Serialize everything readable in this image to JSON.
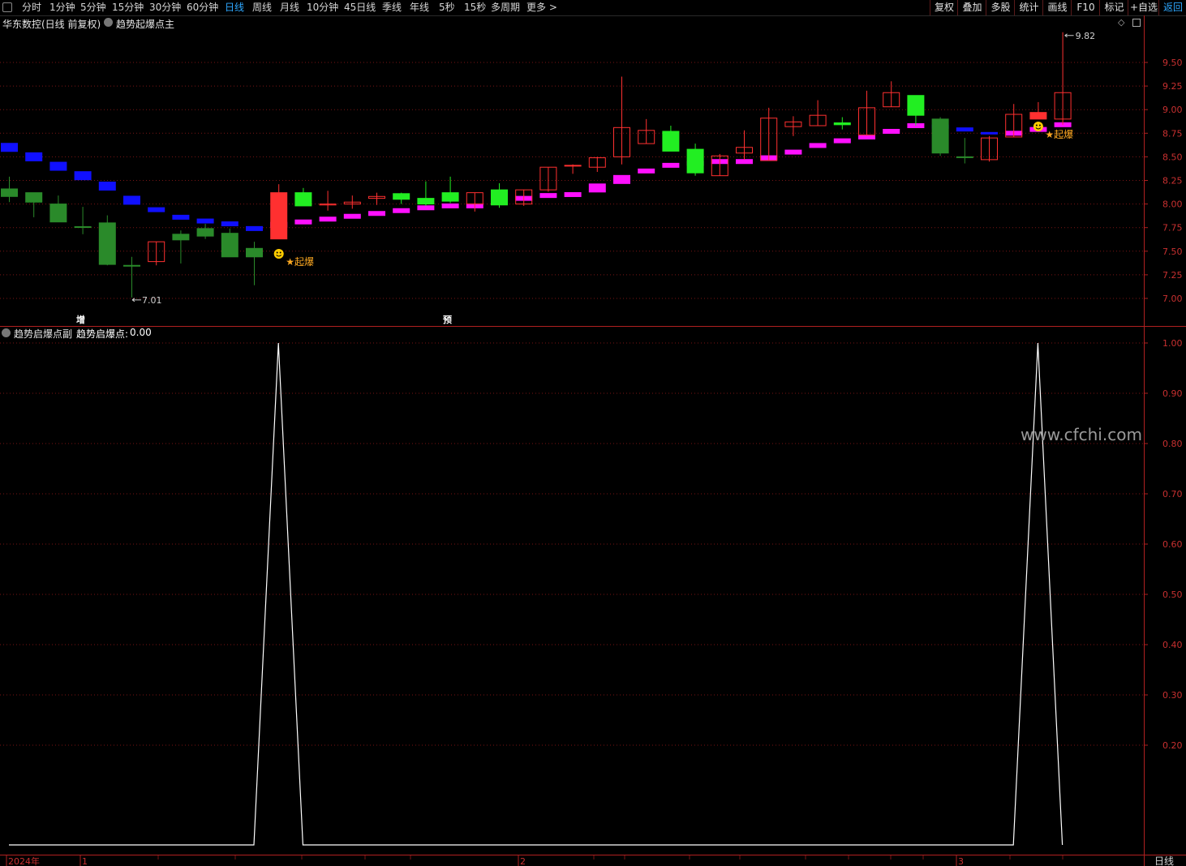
{
  "toolbar": {
    "periods": [
      "分时",
      "1分钟",
      "5分钟",
      "15分钟",
      "30分钟",
      "60分钟",
      "日线",
      "周线",
      "月线",
      "10分钟",
      "45日线",
      "季线",
      "年线",
      "5秒",
      "15秒",
      "多周期",
      "更多 >"
    ],
    "active_period": "日线",
    "actions": [
      "复权",
      "叠加",
      "多股",
      "统计",
      "画线",
      "F10",
      "标记",
      "+自选",
      "返回"
    ]
  },
  "main_panel": {
    "title": "华东数控(日线 前复权)",
    "indicator_name": "趋势起爆点主",
    "price_axis": [
      "9.50",
      "9.25",
      "9.00",
      "8.75",
      "8.50",
      "8.25",
      "8.00",
      "7.75",
      "7.50",
      "7.25",
      "7.00"
    ],
    "high_label": "9.82",
    "low_label": "7.01",
    "signal_label": "★起爆",
    "marker_zeng": "增",
    "marker_yu": "预"
  },
  "sub_panel": {
    "indicator_name": "趋势启爆点副",
    "value_label": "趋势启爆点:",
    "value": "0.00",
    "axis": [
      "1.00",
      "0.90",
      "0.80",
      "0.70",
      "0.60",
      "0.50",
      "0.40",
      "0.30",
      "0.20"
    ]
  },
  "date_axis": {
    "labels": [
      "2024年",
      "1",
      "2",
      "3"
    ],
    "period": "日线"
  },
  "watermark": "www.cfchi.com",
  "colors": {
    "up": "#ff3030",
    "down_dark": "#2a8a2a",
    "down_bright": "#22ee22",
    "band_down": "#1010ff",
    "band_up": "#ff10ff",
    "grid": "#7a1515",
    "active": "#2ea8ff"
  },
  "chart_data": {
    "type": "candlestick",
    "ylim": [
      6.9,
      9.9
    ],
    "candles": [
      {
        "o": 8.16,
        "h": 8.29,
        "l": 8.02,
        "c": 8.08,
        "dir": "down",
        "band": 8.6,
        "bc": "blue"
      },
      {
        "o": 8.12,
        "h": 8.12,
        "l": 7.86,
        "c": 8.02,
        "dir": "down",
        "band": 8.5,
        "bc": "blue"
      },
      {
        "o": 8.0,
        "h": 8.09,
        "l": 7.81,
        "c": 7.81,
        "dir": "down",
        "band": 8.4,
        "bc": "blue"
      },
      {
        "o": 7.76,
        "h": 7.97,
        "l": 7.68,
        "c": 7.76,
        "dir": "down",
        "band": 8.3,
        "bc": "blue"
      },
      {
        "o": 7.8,
        "h": 7.88,
        "l": 7.35,
        "c": 7.36,
        "dir": "down",
        "band": 8.19,
        "bc": "blue"
      },
      {
        "o": 7.35,
        "h": 7.44,
        "l": 7.01,
        "c": 7.35,
        "dir": "down",
        "band": 8.04,
        "bc": "blue"
      },
      {
        "o": 7.39,
        "h": 7.6,
        "l": 7.35,
        "c": 7.6,
        "dir": "up",
        "band": 7.94,
        "bc": "blue"
      },
      {
        "o": 7.62,
        "h": 7.72,
        "l": 7.37,
        "c": 7.68,
        "dir": "down",
        "band": 7.86,
        "bc": "blue"
      },
      {
        "o": 7.66,
        "h": 7.79,
        "l": 7.63,
        "c": 7.74,
        "dir": "down",
        "band": 7.82,
        "bc": "blue"
      },
      {
        "o": 7.69,
        "h": 7.74,
        "l": 7.44,
        "c": 7.44,
        "dir": "down",
        "band": 7.79,
        "bc": "blue"
      },
      {
        "o": 7.53,
        "h": 7.6,
        "l": 7.14,
        "c": 7.44,
        "dir": "down",
        "band": 7.74,
        "bc": "blue"
      },
      {
        "o": 7.63,
        "h": 8.21,
        "l": 7.63,
        "c": 8.12,
        "dir": "up",
        "band": 7.78,
        "bc": "mag",
        "signal": true
      },
      {
        "o": 8.12,
        "h": 8.17,
        "l": 7.98,
        "c": 7.98,
        "dir": "downb",
        "band": 7.81,
        "bc": "mag"
      },
      {
        "o": 8.0,
        "h": 8.14,
        "l": 7.93,
        "c": 7.99,
        "dir": "up",
        "band": 7.84,
        "bc": "mag"
      },
      {
        "o": 8.02,
        "h": 8.09,
        "l": 7.95,
        "c": 8.0,
        "dir": "up",
        "band": 7.87,
        "bc": "mag"
      },
      {
        "o": 8.06,
        "h": 8.12,
        "l": 7.99,
        "c": 8.08,
        "dir": "up",
        "band": 7.9,
        "bc": "mag"
      },
      {
        "o": 8.11,
        "h": 8.12,
        "l": 8.0,
        "c": 8.05,
        "dir": "downb",
        "band": 7.93,
        "bc": "mag"
      },
      {
        "o": 8.06,
        "h": 8.24,
        "l": 7.98,
        "c": 8.0,
        "dir": "downb",
        "band": 7.96,
        "bc": "mag"
      },
      {
        "o": 8.12,
        "h": 8.29,
        "l": 8.01,
        "c": 8.03,
        "dir": "downb",
        "band": 7.98,
        "bc": "mag"
      },
      {
        "o": 8.0,
        "h": 8.12,
        "l": 7.92,
        "c": 8.12,
        "dir": "up",
        "band": 7.98,
        "bc": "mag"
      },
      {
        "o": 8.15,
        "h": 8.22,
        "l": 7.96,
        "c": 7.99,
        "dir": "downb",
        "band": 8.03,
        "bc": "mag"
      },
      {
        "o": 8.0,
        "h": 8.15,
        "l": 7.98,
        "c": 8.15,
        "dir": "up",
        "band": 8.06,
        "bc": "mag"
      },
      {
        "o": 8.15,
        "h": 8.39,
        "l": 8.13,
        "c": 8.39,
        "dir": "up",
        "band": 8.09,
        "bc": "mag"
      },
      {
        "o": 8.41,
        "h": 8.42,
        "l": 8.32,
        "c": 8.41,
        "dir": "up",
        "band": 8.1,
        "bc": "mag"
      },
      {
        "o": 8.39,
        "h": 8.5,
        "l": 8.34,
        "c": 8.49,
        "dir": "up",
        "band": 8.17,
        "bc": "mag"
      },
      {
        "o": 8.5,
        "h": 9.35,
        "l": 8.42,
        "c": 8.81,
        "dir": "up",
        "band": 8.26,
        "bc": "mag"
      },
      {
        "o": 8.64,
        "h": 8.9,
        "l": 8.64,
        "c": 8.78,
        "dir": "up",
        "band": 8.35,
        "bc": "mag"
      },
      {
        "o": 8.77,
        "h": 8.83,
        "l": 8.56,
        "c": 8.56,
        "dir": "downb",
        "band": 8.41,
        "bc": "mag"
      },
      {
        "o": 8.58,
        "h": 8.64,
        "l": 8.3,
        "c": 8.33,
        "dir": "downb",
        "band": 8.43,
        "bc": "mag"
      },
      {
        "o": 8.3,
        "h": 8.53,
        "l": 8.3,
        "c": 8.51,
        "dir": "up",
        "band": 8.45,
        "bc": "mag"
      },
      {
        "o": 8.54,
        "h": 8.78,
        "l": 8.47,
        "c": 8.6,
        "dir": "up",
        "band": 8.45,
        "bc": "mag"
      },
      {
        "o": 8.46,
        "h": 9.02,
        "l": 8.46,
        "c": 8.91,
        "dir": "up",
        "band": 8.49,
        "bc": "mag"
      },
      {
        "o": 8.82,
        "h": 8.93,
        "l": 8.72,
        "c": 8.87,
        "dir": "up",
        "band": 8.55,
        "bc": "mag"
      },
      {
        "o": 8.83,
        "h": 9.1,
        "l": 8.83,
        "c": 8.94,
        "dir": "up",
        "band": 8.62,
        "bc": "mag"
      },
      {
        "o": 8.86,
        "h": 8.92,
        "l": 8.79,
        "c": 8.84,
        "dir": "downb",
        "band": 8.67,
        "bc": "mag"
      },
      {
        "o": 8.73,
        "h": 9.2,
        "l": 8.73,
        "c": 9.02,
        "dir": "up",
        "band": 8.71,
        "bc": "mag"
      },
      {
        "o": 9.03,
        "h": 9.3,
        "l": 9.03,
        "c": 9.18,
        "dir": "up",
        "band": 8.77,
        "bc": "mag"
      },
      {
        "o": 9.15,
        "h": 9.15,
        "l": 8.83,
        "c": 8.94,
        "dir": "downb",
        "band": 8.83,
        "bc": "mag"
      },
      {
        "o": 8.9,
        "h": 8.92,
        "l": 8.51,
        "c": 8.54,
        "dir": "down",
        "band": 8.82,
        "bc": "blue"
      },
      {
        "o": 8.5,
        "h": 8.7,
        "l": 8.43,
        "c": 8.5,
        "dir": "down",
        "band": 8.79,
        "bc": "blue"
      },
      {
        "o": 8.47,
        "h": 8.72,
        "l": 8.45,
        "c": 8.7,
        "dir": "up",
        "band": 8.75,
        "bc": "blue"
      },
      {
        "o": 8.71,
        "h": 9.06,
        "l": 8.71,
        "c": 8.95,
        "dir": "up",
        "band": 8.75,
        "bc": "mag"
      },
      {
        "o": 8.9,
        "h": 9.08,
        "l": 8.9,
        "c": 8.97,
        "dir": "upf",
        "band": 8.79,
        "bc": "mag",
        "signal": true
      },
      {
        "o": 8.9,
        "h": 9.82,
        "l": 8.84,
        "c": 9.18,
        "dir": "up",
        "band": 8.84,
        "bc": "mag"
      }
    ],
    "sub_series": {
      "peaks": [
        11,
        42
      ],
      "values_base": 0.0,
      "values_peak": 1.0
    }
  }
}
